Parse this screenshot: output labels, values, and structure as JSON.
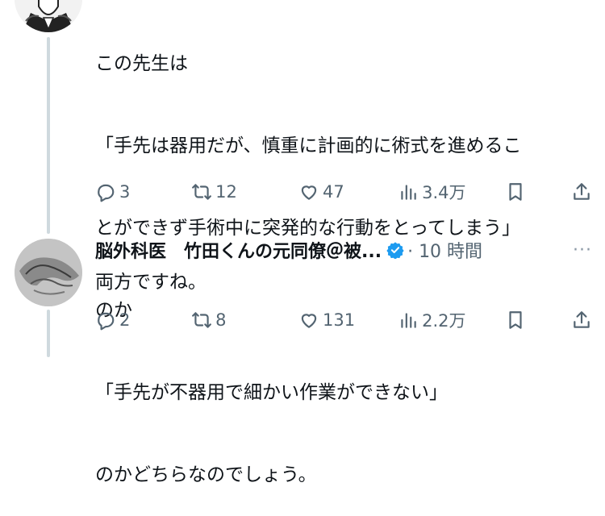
{
  "colors": {
    "accent": "#1d9bf0",
    "muted": "#536471",
    "text": "#0f1419",
    "thread_line": "#cfd9de"
  },
  "tweet1": {
    "lines": [
      "この先生は",
      "「手先は器用だが、慎重に計画的に術式を進めるこ",
      "とができず手術中に突発的な行動をとってしまう」",
      "のか",
      "「手先が不器用で細かい作業ができない」",
      "のかどちらなのでしょう。"
    ],
    "replies": "3",
    "retweets": "12",
    "likes": "47",
    "views": "3.4万"
  },
  "tweet2": {
    "name": "脳外科医　竹田くんの元同僚＠被...",
    "time": "· 10 時間",
    "more": "···",
    "text": "両方ですね。",
    "replies": "2",
    "retweets": "8",
    "likes": "131",
    "views": "2.2万"
  },
  "icons": [
    "reply-icon",
    "retweet-icon",
    "like-icon",
    "views-icon",
    "bookmark-icon",
    "share-icon",
    "verified-icon",
    "more-icon"
  ]
}
